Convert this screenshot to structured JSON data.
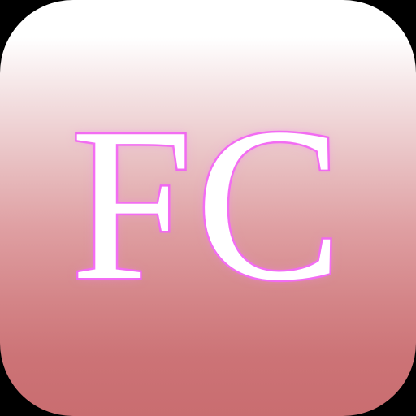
{
  "app_icon": {
    "monogram": "FC",
    "colors": {
      "gradient_top": "#ffffff",
      "gradient_bottom": "#c96d70",
      "letter_fill": "#ffffff",
      "letter_outline": "#ee66ee",
      "outside_background": "#000000"
    }
  }
}
